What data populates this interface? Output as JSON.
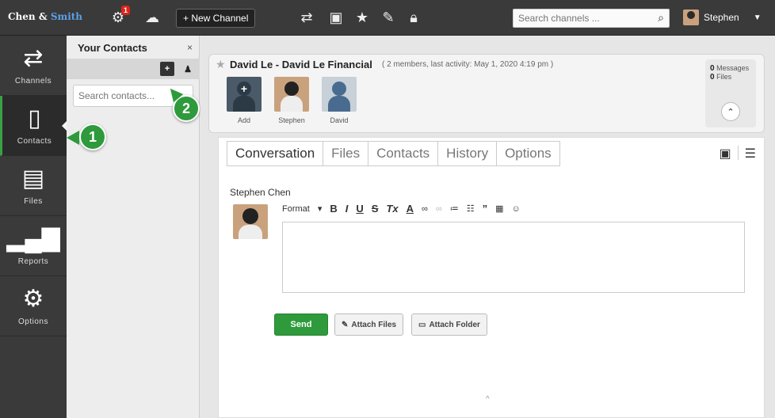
{
  "app": {
    "brand_part1": "Chen & ",
    "brand_part2": "Smith"
  },
  "topbar": {
    "notification_count": "1",
    "new_channel_label": "+ New Channel",
    "search_placeholder": "Search channels ...",
    "user_name": "Stephen"
  },
  "leftnav": {
    "items": [
      {
        "label": "Channels",
        "icon": "swap-arrows-icon"
      },
      {
        "label": "Contacts",
        "icon": "book-icon"
      },
      {
        "label": "Files",
        "icon": "file-icon"
      },
      {
        "label": "Reports",
        "icon": "bar-chart-icon"
      },
      {
        "label": "Options",
        "icon": "gear-icon"
      }
    ],
    "active": "Contacts"
  },
  "contacts": {
    "title": "Your Contacts",
    "close": "×",
    "search_placeholder": "Search contacts..."
  },
  "callouts": {
    "one": "1",
    "two": "2"
  },
  "channel": {
    "title": "David Le - David Le Financial",
    "meta": "( 2 members, last activity: May 1, 2020 4:19 pm )",
    "members": [
      {
        "name": "Add"
      },
      {
        "name": "Stephen"
      },
      {
        "name": "David"
      }
    ],
    "messages_count": "0",
    "messages_label": "Messages",
    "files_count": "0",
    "files_label": "Files"
  },
  "conversation": {
    "tabs": [
      "Conversation",
      "Files",
      "Contacts",
      "History",
      "Options"
    ],
    "author": "Stephen Chen",
    "format_label": "Format",
    "send_label": "Send",
    "attach_files_label": "Attach Files",
    "attach_folder_label": "Attach Folder"
  },
  "colors": {
    "accent_green": "#2e9a3c",
    "brand_blue": "#5aa0e8",
    "dark": "#3a3a3a",
    "badge_red": "#d9261c"
  }
}
